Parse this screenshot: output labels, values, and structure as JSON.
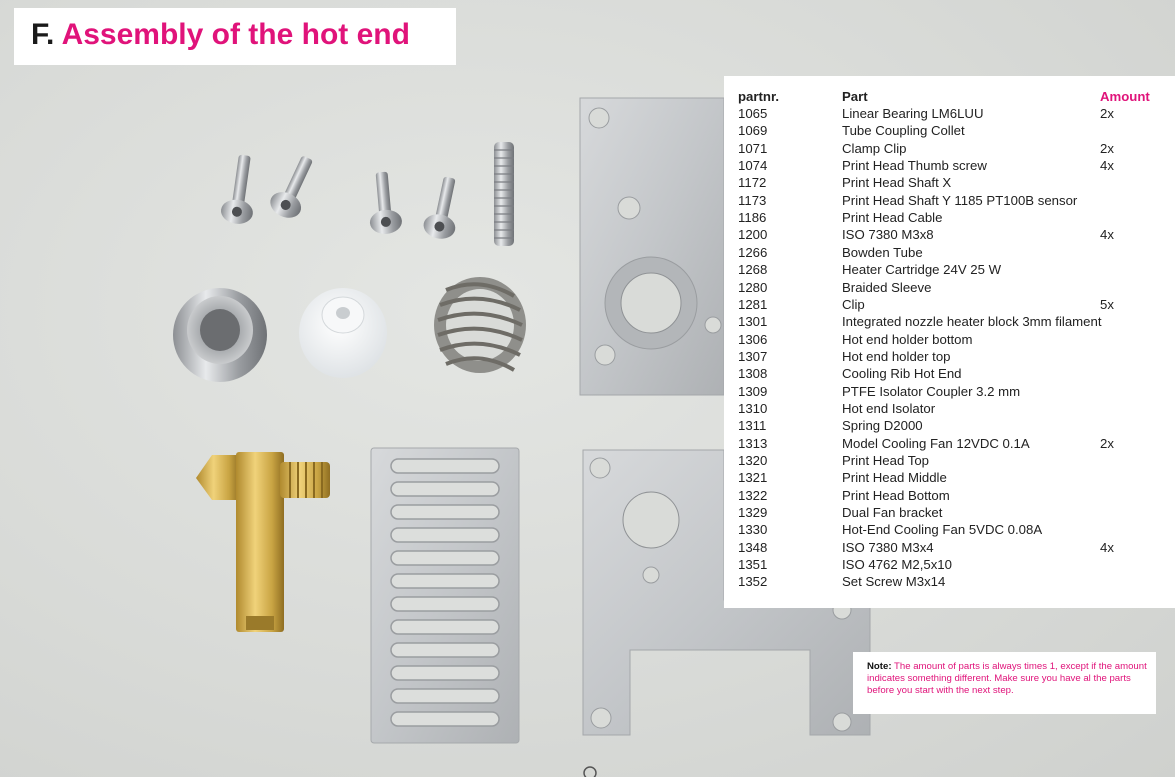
{
  "title": {
    "prefix": "F.",
    "text": "Assembly of the hot end"
  },
  "parts_table": {
    "headers": {
      "partnr": "partnr.",
      "part": "Part",
      "amount": "Amount"
    },
    "rows": [
      {
        "nr": "1065",
        "part": "Linear Bearing LM6LUU",
        "amount": "2x"
      },
      {
        "nr": "1069",
        "part": "Tube Coupling Collet",
        "amount": ""
      },
      {
        "nr": "1071",
        "part": "Clamp Clip",
        "amount": "2x"
      },
      {
        "nr": "1074",
        "part": "Print Head Thumb screw",
        "amount": "4x"
      },
      {
        "nr": "1172",
        "part": "Print Head Shaft X",
        "amount": ""
      },
      {
        "nr": "1173",
        "part": "Print Head Shaft Y 1185 PT100B sensor",
        "amount": ""
      },
      {
        "nr": "1186",
        "part": "Print Head Cable",
        "amount": ""
      },
      {
        "nr": "1200",
        "part": "ISO 7380 M3x8",
        "amount": "4x"
      },
      {
        "nr": "1266",
        "part": "Bowden Tube",
        "amount": ""
      },
      {
        "nr": "1268",
        "part": "Heater Cartridge 24V 25 W",
        "amount": ""
      },
      {
        "nr": "1280",
        "part": "Braided Sleeve",
        "amount": ""
      },
      {
        "nr": "1281",
        "part": "Clip",
        "amount": "5x"
      },
      {
        "nr": "1301",
        "part": "Integrated nozzle heater block 3mm filament",
        "amount": ""
      },
      {
        "nr": "1306",
        "part": "Hot end holder bottom",
        "amount": ""
      },
      {
        "nr": "1307",
        "part": "Hot end holder top",
        "amount": ""
      },
      {
        "nr": "1308",
        "part": "Cooling Rib Hot End",
        "amount": ""
      },
      {
        "nr": "1309",
        "part": "PTFE Isolator Coupler 3.2 mm",
        "amount": ""
      },
      {
        "nr": "1310",
        "part": "Hot end Isolator",
        "amount": ""
      },
      {
        "nr": "1311",
        "part": "Spring D2000",
        "amount": ""
      },
      {
        "nr": "1313",
        "part": "Model Cooling Fan 12VDC 0.1A",
        "amount": "2x"
      },
      {
        "nr": "1320",
        "part": "Print Head Top",
        "amount": ""
      },
      {
        "nr": "1321",
        "part": "Print Head Middle",
        "amount": ""
      },
      {
        "nr": "1322",
        "part": "Print Head Bottom",
        "amount": ""
      },
      {
        "nr": "1329",
        "part": "Dual Fan bracket",
        "amount": ""
      },
      {
        "nr": "1330",
        "part": "Hot-End Cooling Fan 5VDC 0.08A",
        "amount": ""
      },
      {
        "nr": "1348",
        "part": "ISO 7380 M3x4",
        "amount": "4x"
      },
      {
        "nr": "1351",
        "part": "ISO 4762 M2,5x10",
        "amount": ""
      },
      {
        "nr": "1352",
        "part": "Set Screw M3x14",
        "amount": ""
      }
    ]
  },
  "note": {
    "label": "Note:",
    "text": "The amount of parts is always times 1, except if the amount indicates something different. Make sure you have al the parts before you start with the next step."
  },
  "colors": {
    "accent": "#e0137a",
    "text": "#222222",
    "background": "#d9dbd8"
  }
}
